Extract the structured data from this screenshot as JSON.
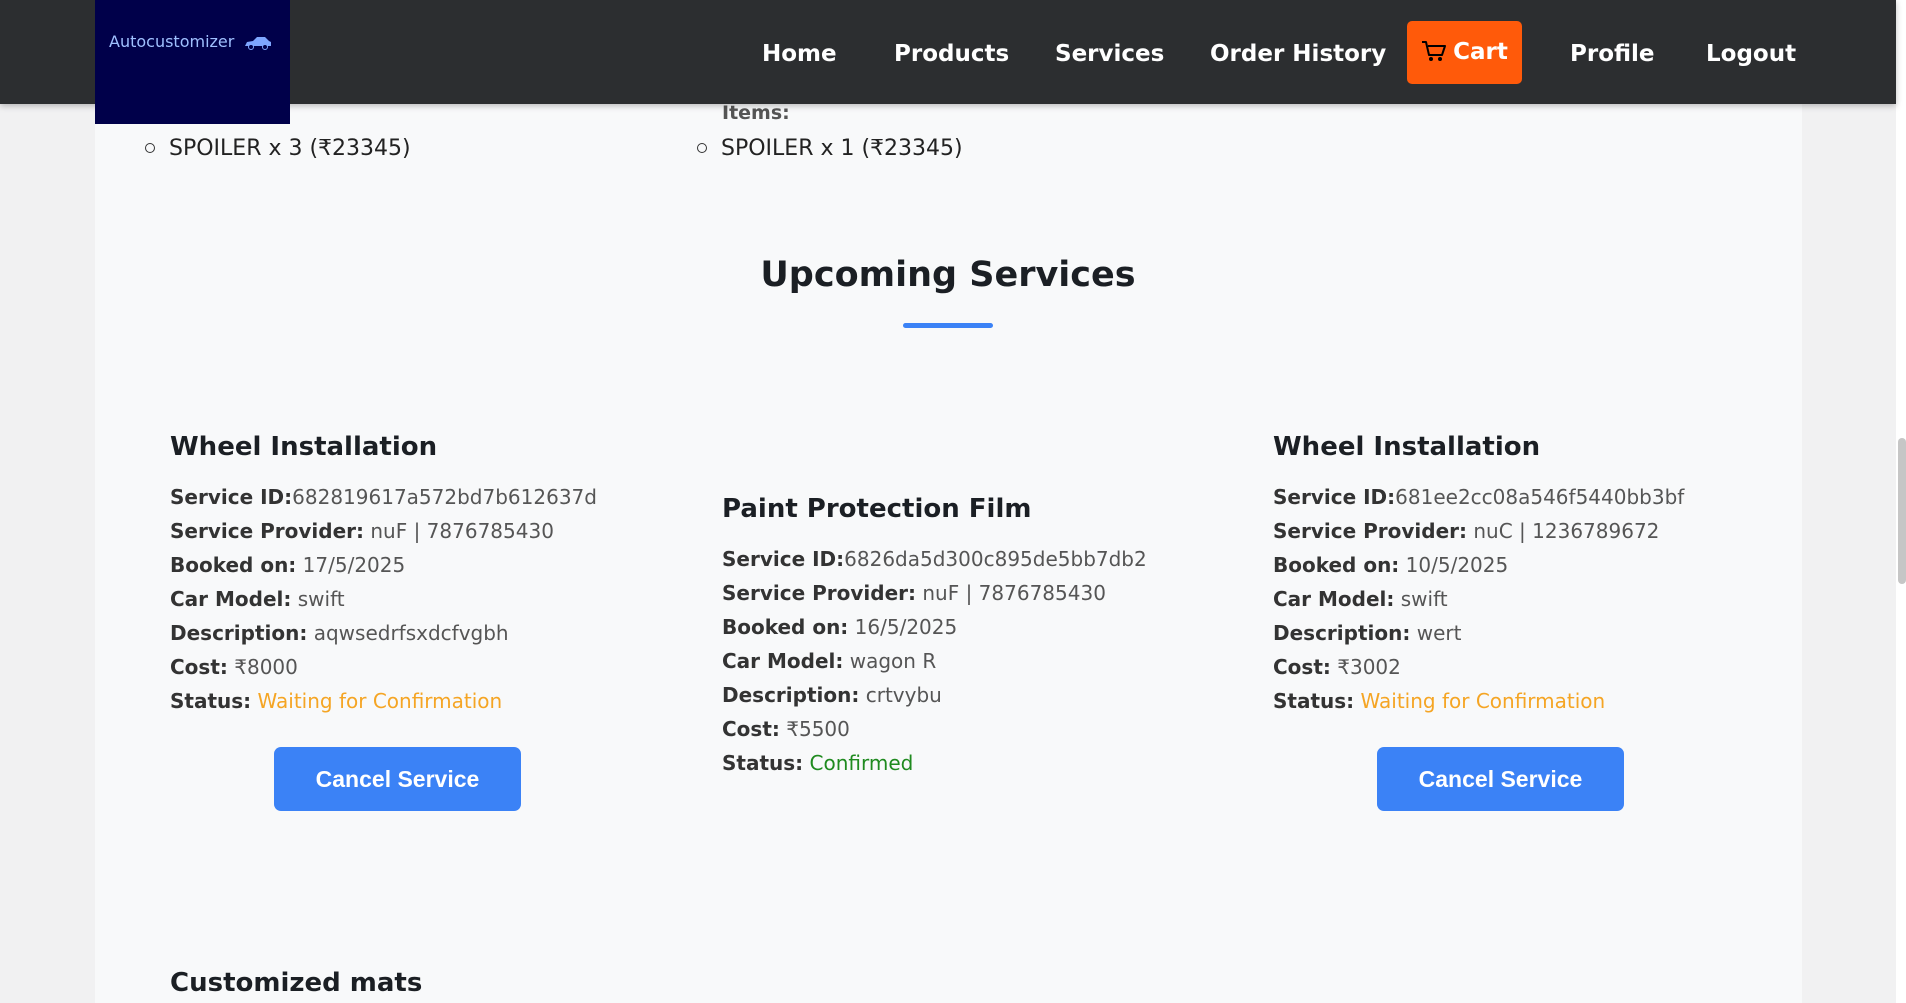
{
  "navbar": {
    "logo_text": "Autocustomizer",
    "logo_icon": "car-icon",
    "items": [
      {
        "label": "Home"
      },
      {
        "label": "Products"
      },
      {
        "label": "Services"
      },
      {
        "label": "Order History"
      },
      {
        "label": "Cart",
        "icon": "cart-icon"
      },
      {
        "label": "Profile"
      },
      {
        "label": "Logout"
      }
    ]
  },
  "orders": {
    "items_label": "Items:",
    "left_item": "SPOILER x 3 (₹23345)",
    "right_item": "SPOILER x 1 (₹23345)"
  },
  "upcoming": {
    "title": "Upcoming Services",
    "cancel_label": "Cancel Service",
    "labels": {
      "service_id": "Service ID:",
      "provider": "Service Provider:",
      "booked_on": "Booked on:",
      "car_model": "Car Model:",
      "description": "Description:",
      "cost": "Cost:",
      "status": "Status:"
    },
    "cards": [
      {
        "title": "Wheel Installation",
        "service_id": "682819617a572bd7b612637d",
        "provider": "nuF | 7876785430",
        "booked_on": "17/5/2025",
        "car_model": "swift",
        "description": "aqwsedrfsxdcfvgbh",
        "cost": "₹8000",
        "status": "Waiting for Confirmation"
      },
      {
        "title": "Paint Protection Film",
        "service_id": "6826da5d300c895de5bb7db2",
        "provider": "nuF | 7876785430",
        "booked_on": "16/5/2025",
        "car_model": "wagon R",
        "description": "crtvybu",
        "cost": "₹5500",
        "status": "Confirmed"
      },
      {
        "title": "Wheel Installation",
        "service_id": "681ee2cc08a546f5440bb3bf",
        "provider": "nuC | 1236789672",
        "booked_on": "10/5/2025",
        "car_model": "swift",
        "description": "wert",
        "cost": "₹3002",
        "status": "Waiting for Confirmation"
      }
    ],
    "next_card_title": "Customized mats"
  },
  "colors": {
    "navbar_bg": "#2c2e30",
    "logo_bg": "#00004a",
    "cart_accent": "#ff5a0a",
    "primary_button": "#3b82f6",
    "status_waiting": "#f5a524",
    "status_confirmed": "#1f8a1f"
  }
}
